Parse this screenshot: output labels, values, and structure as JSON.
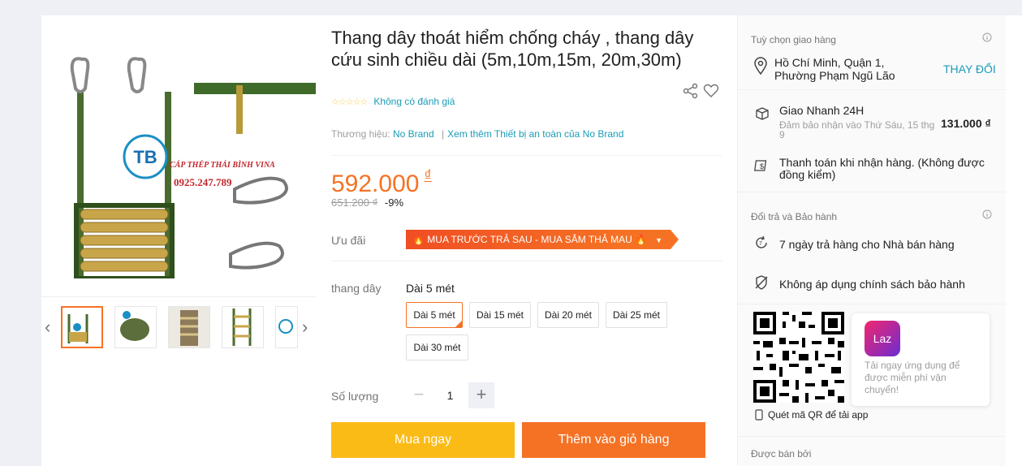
{
  "product": {
    "title": "Thang dây thoát hiểm chống cháy , thang dây cứu sinh chiều dài (5m,10m,15m, 20m,30m)",
    "rating_text": "Không có đánh giá",
    "brand_label": "Thương hiệu:",
    "brand_name": "No Brand",
    "brand_more": "Xem thêm Thiết bị an toàn của No Brand",
    "price": "592.000",
    "currency": "₫",
    "old_price": "651.200 ₫",
    "discount": "-9%",
    "promo_label": "Ưu đãi",
    "promo_text": "🔥 MUA TRƯỚC TRẢ SAU - MUA SẮM THẢ MAU 🔥",
    "variant_label": "thang dây",
    "variant_selected": "Dài 5 mét",
    "options": [
      "Dài 5 mét",
      "Dài 15 mét",
      "Dài 20 mét",
      "Dài 25 mét",
      "Dài 30 mét"
    ],
    "qty_label": "Số lượng",
    "qty": "1",
    "buy_now": "Mua ngay",
    "add_to_cart": "Thêm vào giỏ hàng",
    "watermark_name": "CÁP THÉP THÁI BÌNH VINA",
    "watermark_phone": "0925.247.789",
    "watermark_logo": "TB"
  },
  "delivery": {
    "title": "Tuỳ chọn giao hàng",
    "address_line1": "Hồ Chí Minh, Quận 1,",
    "address_line2": "Phường Phạm Ngũ Lão",
    "change": "THAY ĐỔI",
    "method": "Giao Nhanh 24H",
    "method_sub1": "Đảm bảo nhận vào Thứ Sáu, 15 thg",
    "method_sub2": "9",
    "fee": "131.000 ₫",
    "cod_line1": "Thanh toán khi nhận hàng. (Không được",
    "cod_line2": "đồng kiểm)"
  },
  "returns": {
    "title": "Đổi trả và Bảo hành",
    "return_policy": "7 ngày trả hàng cho Nhà bán hàng",
    "warranty": "Không áp dụng chính sách bảo hành"
  },
  "app": {
    "logo_text": "Laz",
    "promo_line": "Tải ngay ứng dụng để được miễn phí vận chuyển!",
    "qr_note": "Quét mã QR để tải app"
  },
  "seller": {
    "title": "Được bán bởi"
  },
  "colors": {
    "accent_orange": "#f57224",
    "buy_yellow": "#fbbb17",
    "link_blue": "#1a9cb7"
  }
}
